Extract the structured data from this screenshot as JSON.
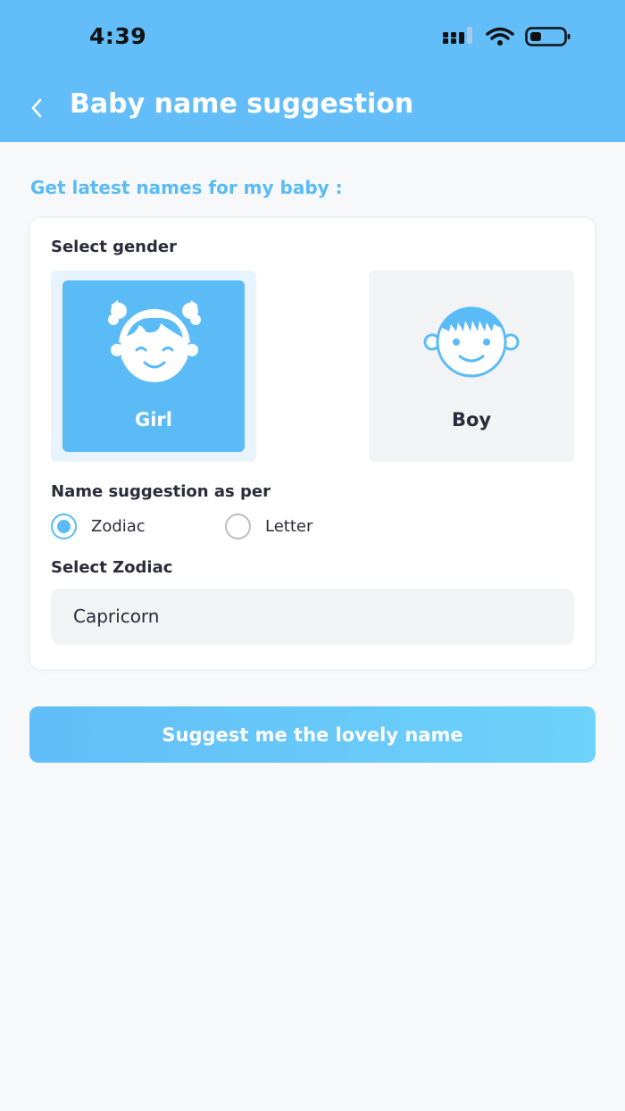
{
  "status_bar": {
    "time": "4:39"
  },
  "header": {
    "title": "Baby name suggestion"
  },
  "section": {
    "heading": "Get latest names for my baby :"
  },
  "gender": {
    "label": "Select gender",
    "options": [
      {
        "label": "Girl",
        "icon": "girl-face-icon",
        "selected": true
      },
      {
        "label": "Boy",
        "icon": "boy-face-icon",
        "selected": false
      }
    ]
  },
  "suggestion_mode": {
    "label": "Name suggestion as per",
    "options": [
      {
        "label": "Zodiac",
        "selected": true
      },
      {
        "label": "Letter",
        "selected": false
      }
    ]
  },
  "zodiac": {
    "label": "Select Zodiac",
    "value": "Capricorn"
  },
  "action": {
    "label": "Suggest me the lovely name"
  },
  "colors": {
    "accent": "#62bdf8",
    "text": "#2b2b3a",
    "muted_bg": "#f2f3f4"
  }
}
